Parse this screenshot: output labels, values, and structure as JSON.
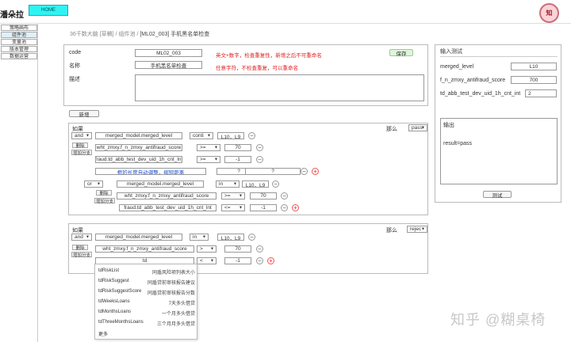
{
  "app": {
    "logo": "潘朵拉",
    "home_label": "HOME",
    "avatar_text": "知"
  },
  "sidebar": {
    "items": [
      {
        "label": "策略画布",
        "active": false
      },
      {
        "label": "组件池",
        "active": true
      },
      {
        "label": "变量池",
        "active": false
      },
      {
        "label": "版本管理",
        "active": false
      },
      {
        "label": "数据运营",
        "active": false
      }
    ]
  },
  "breadcrumb": {
    "root": "36千数大脑 [草稿]",
    "sep": "/",
    "mid": "组件池",
    "last": "[ML02_003] 手机黑名单检查"
  },
  "form": {
    "code_label": "code",
    "code_value": "ML02_003",
    "code_hint": "英文+数字，检查重复性，新增之后不可重命名",
    "name_label": "名称",
    "name_value": "手机黑名单检查",
    "name_hint": "任意字符，不检查重复，可以重命名",
    "desc_label": "描述",
    "desc_value": "",
    "save_label": "保存"
  },
  "new_button": "新增",
  "rule1": {
    "if_label": "如果",
    "then_label": "那么",
    "result": "pass",
    "logic": "and",
    "delete_label": "删除",
    "add_branch_label": "增加分支",
    "conditions": [
      {
        "field": "merged_model.merged_level",
        "op": "conti",
        "value": "L10，L9"
      },
      {
        "field": "wht_zmxy.f_n_zmxy_antifraud_score",
        "op": ">=",
        "value": "70"
      },
      {
        "field": "fraud.td_abb_test_dev_uid_1h_cnt_lnt",
        "op": ">=",
        "value": "-1"
      }
    ],
    "hint_text": "框的长度自动调整，缩短距离",
    "hint_box1": "?",
    "hint_box2": "?",
    "sub": {
      "logic": "or",
      "delete_label": "删除",
      "add_branch_label": "增加分支",
      "conditions": [
        {
          "field": "merged_model.merged_level",
          "op": "in",
          "value": "L10，L9"
        },
        {
          "field": "wht_zmxy.f_n_zmxy_antifraud_score",
          "op": ">=",
          "value": "70"
        },
        {
          "field": "fraud.td_abb_test_dev_uid_1h_cnt_lnt",
          "op": "<=",
          "value": "-1"
        }
      ]
    }
  },
  "rule2": {
    "if_label": "如果",
    "then_label": "那么",
    "result": "rejec",
    "logic": "and",
    "delete_label": "删除",
    "add_branch_label": "增加分支",
    "conditions": [
      {
        "field": "merged_model.merged_level",
        "op": "in",
        "value": "L10，L9"
      },
      {
        "field": "wht_zmxy.f_n_zmxy_antifraud_score",
        "op": ">",
        "value": "70"
      },
      {
        "field": "td",
        "op": "<",
        "value": "-1"
      }
    ]
  },
  "autocomplete": [
    {
      "key": "tdRiskList",
      "desc": "同盾风险项列表大小"
    },
    {
      "key": "tdRiskSuggest",
      "desc": "同盾贷前审核报告建议"
    },
    {
      "key": "tdRiskSuggestScore",
      "desc": "同盾贷前审核报告分数"
    },
    {
      "key": "tdWeeksLoans",
      "desc": "7天多头借贷"
    },
    {
      "key": "tdMonthsLoans",
      "desc": "一个月多头借贷"
    },
    {
      "key": "tdThreeMonthsLoans",
      "desc": "三个月月多头借贷"
    },
    {
      "key": "更多",
      "desc": ""
    }
  ],
  "test_panel": {
    "tab_label": "输入测试",
    "inputs": [
      {
        "name": "merged_level",
        "value": "L10"
      },
      {
        "name": "f_n_zmxy_antifraud_score",
        "value": "700"
      },
      {
        "name": "td_abb_test_dev_uid_1h_cnt_int",
        "value": "2"
      }
    ],
    "output_label": "输出",
    "output_value": "result=pass",
    "test_button": "测试"
  },
  "watermark": "知乎 @糊桌椅"
}
